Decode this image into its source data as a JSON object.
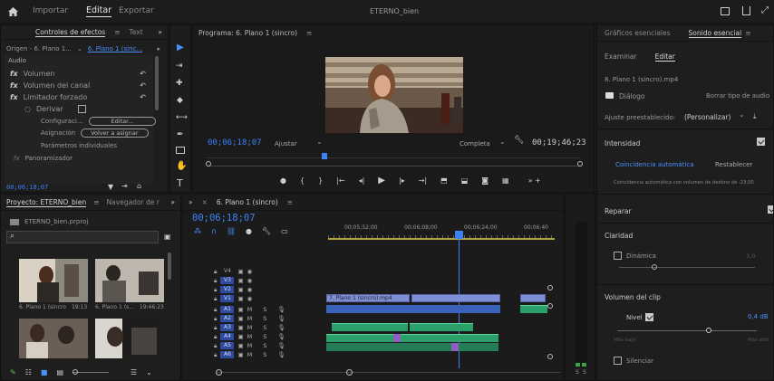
{
  "menubar": {
    "home_icon": "home-icon",
    "items": [
      "Importar",
      "Editar",
      "Exportar"
    ],
    "active_index": 1,
    "project_title": "ETERNO_bien"
  },
  "effects_panel": {
    "tabs": [
      "Controles de efectos",
      "Text"
    ],
    "source_label": "Origen - 6. Plano 1...",
    "sequence_label": "6. Plano 1 (sinc...",
    "section": "Audio",
    "effects": [
      "Volumen",
      "Volumen del canal",
      "Limitador forzado"
    ],
    "bypass_label": "Derivar",
    "config_label": "Configuraci...",
    "config_button": "Editar...",
    "assign_label": "Asignación",
    "assign_button": "Volver a asignar",
    "params_label": "Parámetros individuales",
    "pan_label": "Panoramizador",
    "timecode": "00;06;18;07"
  },
  "program_monitor": {
    "title": "Programa: 6. Plano 1 (sincro)",
    "current_time": "00;06;18;07",
    "fit_label": "Ajustar",
    "quality_label": "Completa",
    "duration": "00;19;46;23"
  },
  "project_panel": {
    "tabs": [
      "Proyecto: ETERNO_bien",
      "Navegador de r"
    ],
    "file_name": "ETERNO_bien.prproj",
    "thumbs": [
      {
        "name": "6. Plano 1 (sincro",
        "dur": "19:13"
      },
      {
        "name": "6. Plano 1 (s...",
        "dur": "19:46:23"
      }
    ]
  },
  "timeline": {
    "sequence_tab": "6. Plano 1 (sincro)",
    "timecode": "00;06;18;07",
    "ruler_labels": [
      "00;05;52;00",
      "00;06;08;00",
      "00;06;24;00",
      "00;06:40"
    ],
    "video_tracks": [
      "V4",
      "V3",
      "V2",
      "V1"
    ],
    "audio_tracks": [
      "A1",
      "A2",
      "A3",
      "A4",
      "A5",
      "A6"
    ],
    "clip_label": "7. Plano 1 (sincro).mp4",
    "mix_levels": [
      "S",
      "S"
    ]
  },
  "essential_sound": {
    "tabs": [
      "Gráficos esenciales",
      "Sonido esencial"
    ],
    "subtabs": [
      "Examinar",
      "Editar"
    ],
    "clip_name": "8. Plano 1 (sincro).mp4",
    "type_label": "Diálogo",
    "clear_type_button": "Borrar tipo de audio",
    "preset_label": "Ajuste preestablecido:",
    "preset_value": "(Personalizar)",
    "loudness_label": "Intensidad",
    "auto_match_button": "Coincidencia automática",
    "reset_button": "Restablecer",
    "auto_match_note": "Coincidencia automática con volumen de destino de -23,00",
    "repair_label": "Reparar",
    "clarity_label": "Claridad",
    "dynamics_label": "Dinámica",
    "dynamics_value": "3,0",
    "clip_volume_label": "Volumen del clip",
    "level_label": "Nivel",
    "level_value": "0,4 dB",
    "level_min": "Más bajo",
    "level_max": "Más alto",
    "mute_label": "Silenciar"
  }
}
